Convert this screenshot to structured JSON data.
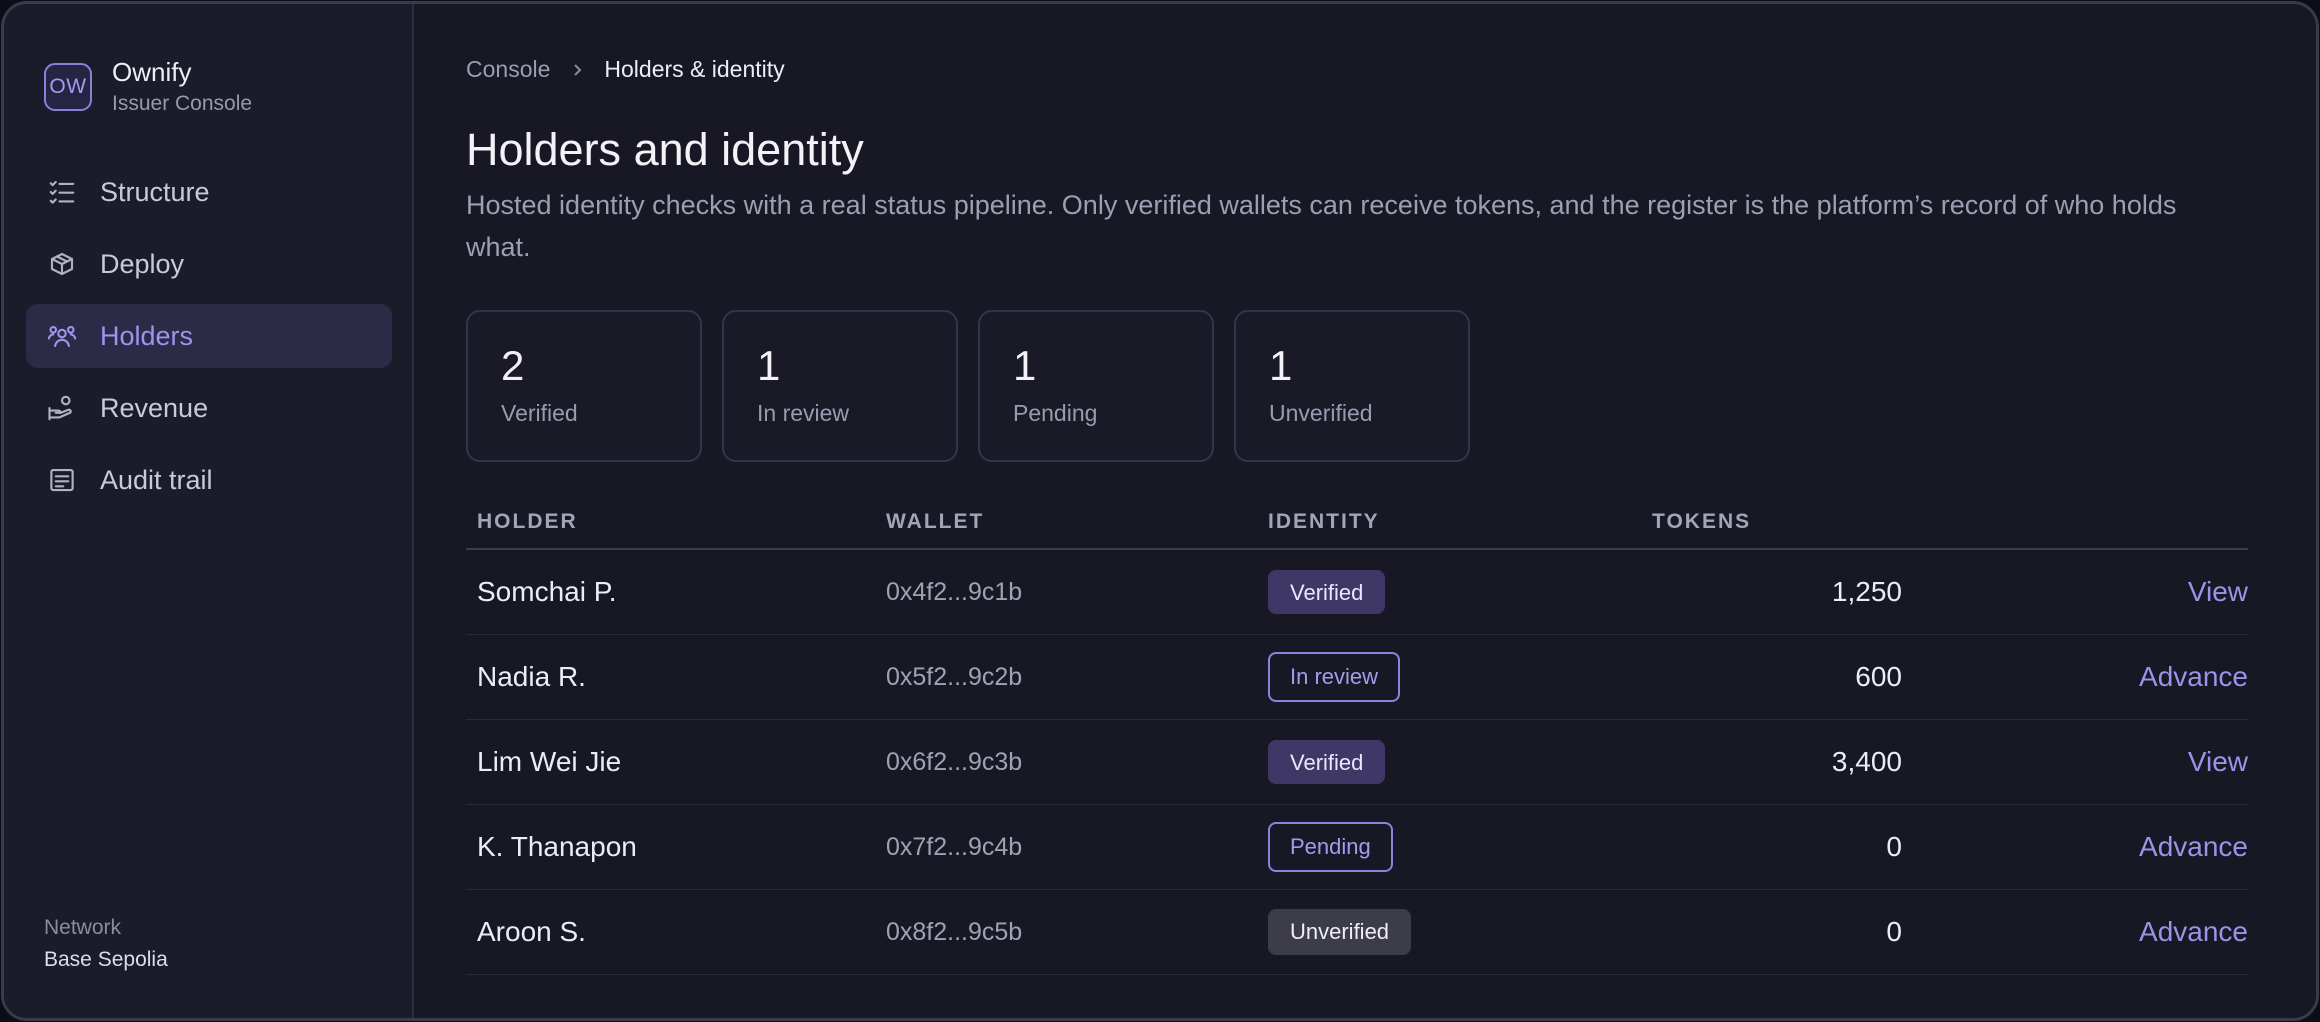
{
  "brand": {
    "logo_text": "OW",
    "name": "Ownify",
    "subtitle": "Issuer Console"
  },
  "sidebar": {
    "items": [
      {
        "label": "Structure",
        "icon": "list-checks-icon",
        "active": false
      },
      {
        "label": "Deploy",
        "icon": "cube-icon",
        "active": false
      },
      {
        "label": "Holders",
        "icon": "users-icon",
        "active": true
      },
      {
        "label": "Revenue",
        "icon": "hand-coins-icon",
        "active": false
      },
      {
        "label": "Audit trail",
        "icon": "receipt-icon",
        "active": false
      }
    ],
    "network_label": "Network",
    "network_value": "Base Sepolia"
  },
  "breadcrumb": {
    "root": "Console",
    "current": "Holders & identity"
  },
  "page": {
    "title": "Holders and identity",
    "description": "Hosted identity checks with a real status pipeline. Only verified wallets can receive tokens, and the register is the platform’s record of who holds what."
  },
  "stats": [
    {
      "value": "2",
      "label": "Verified"
    },
    {
      "value": "1",
      "label": "In review"
    },
    {
      "value": "1",
      "label": "Pending"
    },
    {
      "value": "1",
      "label": "Unverified"
    }
  ],
  "table": {
    "headers": {
      "holder": "HOLDER",
      "wallet": "WALLET",
      "identity": "IDENTITY",
      "tokens": "TOKENS"
    },
    "rows": [
      {
        "holder": "Somchai P.",
        "wallet": "0x4f2...9c1b",
        "identity": "Verified",
        "status": "verified",
        "tokens": "1,250",
        "action": "View"
      },
      {
        "holder": "Nadia R.",
        "wallet": "0x5f2...9c2b",
        "identity": "In review",
        "status": "review",
        "tokens": "600",
        "action": "Advance"
      },
      {
        "holder": "Lim Wei Jie",
        "wallet": "0x6f2...9c3b",
        "identity": "Verified",
        "status": "verified",
        "tokens": "3,400",
        "action": "View"
      },
      {
        "holder": "K. Thanapon",
        "wallet": "0x7f2...9c4b",
        "identity": "Pending",
        "status": "pending",
        "tokens": "0",
        "action": "Advance"
      },
      {
        "holder": "Aroon S.",
        "wallet": "0x8f2...9c5b",
        "identity": "Unverified",
        "status": "unverified",
        "tokens": "0",
        "action": "Advance"
      }
    ]
  },
  "colors": {
    "accent": "#9e94ec",
    "background": "#171823",
    "sidebar": "#1b1c2a"
  }
}
